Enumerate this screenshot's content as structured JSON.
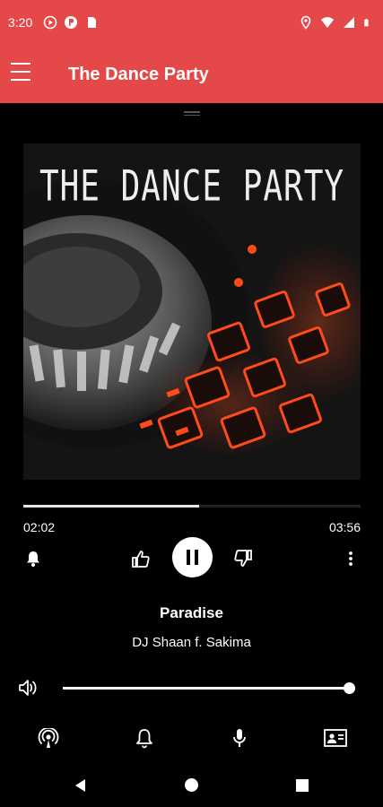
{
  "status_bar": {
    "time": "3:20",
    "left_icons": [
      "play-circle-icon",
      "p-icon",
      "sim-card-icon"
    ],
    "right_icons": [
      "location-icon",
      "wifi-icon",
      "signal-icon",
      "battery-icon"
    ]
  },
  "app_bar": {
    "title": "The Dance Party",
    "menu_icon": "hamburger-menu-icon"
  },
  "album_art": {
    "text": "THE DANCE PARTY"
  },
  "player": {
    "elapsed": "02:02",
    "total": "03:56",
    "progress": 0.52,
    "track_title": "Paradise",
    "track_artist": "DJ Shaan f. Sakima",
    "volume": 1.0,
    "state": "playing"
  },
  "bottom_actions": [
    "podcast-icon",
    "bell-icon",
    "microphone-icon",
    "contact-card-icon"
  ],
  "nav": [
    "back-icon",
    "home-icon",
    "recents-icon"
  ],
  "colors": {
    "accent": "#e54848",
    "background": "#000000"
  }
}
